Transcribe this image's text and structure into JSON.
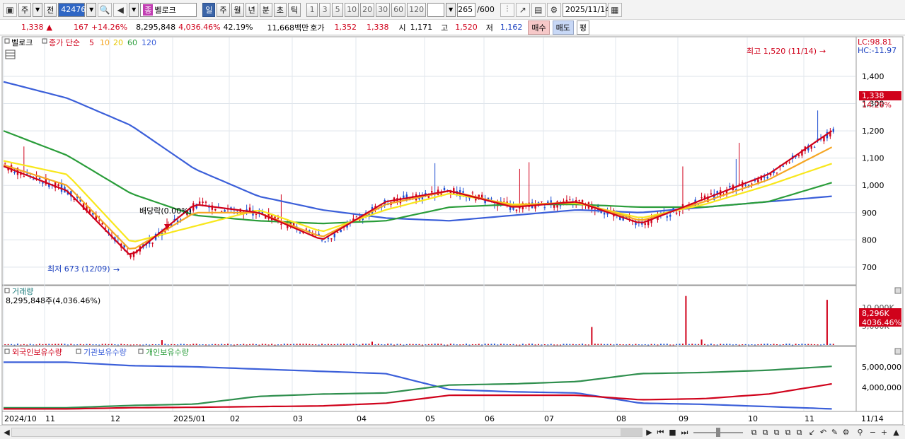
{
  "toolbar": {
    "period_sel": "주",
    "prev_label": "전",
    "stock_code": "424760",
    "stock_badge": "종",
    "stock_name": "벨로크",
    "period_buttons": [
      "일",
      "주",
      "월",
      "년",
      "분",
      "초",
      "틱"
    ],
    "interval_buttons": [
      "1",
      "3",
      "5",
      "10",
      "20",
      "30",
      "60",
      "120"
    ],
    "bar_count": "265",
    "bar_max": "/600",
    "date": "2025/11/14"
  },
  "quote": {
    "price": "1,338",
    "up_arrow": "▲",
    "change": "167",
    "change_pct": "+14.26%",
    "volume": "8,295,848",
    "volume_pct": "4,036.46%",
    "turnover_pct": "42.19%",
    "amount": "11,668백만",
    "hoga_label": "호가",
    "ask": "1,352",
    "bid": "1,338",
    "open_label": "시",
    "open": "1,171",
    "high_label": "고",
    "high": "1,520",
    "low_label": "저",
    "low": "1,162",
    "buy_label": "매수",
    "sell_label": "매도",
    "even_label": "평"
  },
  "price_panel": {
    "stock_label": "벨로크",
    "ma_title": "종가 단순",
    "ma_periods": [
      "5",
      "10",
      "20",
      "60",
      "120"
    ],
    "lc": "LC:98.81",
    "hc": "HC:-11.97",
    "high_note": "최고 1,520 (11/14)",
    "low_note": "최저 673 (12/09)",
    "dividend_note": "배당락(0.00%)",
    "price_tag": "1,338",
    "pct_tag": "14.26%",
    "y_ticks": [
      "1,400",
      "1,300",
      "1,200",
      "1,100",
      "1,000",
      "900",
      "800",
      "700"
    ]
  },
  "volume_panel": {
    "title": "거래량",
    "value_line": "8,295,848주(4,036.46%)",
    "tick_10000k": "10,000K",
    "tick_5000k": "5,000K",
    "tag_vol": "8,296K",
    "tag_pct": "4036.46%"
  },
  "holdings_panel": {
    "legend": [
      "외국인보유수량",
      "기관보유수량",
      "개인보유수량"
    ],
    "y_ticks": [
      "5,000,000",
      "4,000,000"
    ]
  },
  "x_axis": [
    "2024/10",
    "11",
    "12",
    "2025/01",
    "02",
    "03",
    "04",
    "05",
    "06",
    "07",
    "08",
    "09",
    "10",
    "11",
    "11/14"
  ],
  "chart_data": {
    "type": "line",
    "title": "벨로크",
    "ylim": [
      640,
      1540
    ],
    "price_series": {
      "name": "종가",
      "x": [
        "2024/10",
        "2024/11",
        "2024/12",
        "2025/01",
        "2025/02",
        "2025/03",
        "2025/04",
        "2025/05",
        "2025/06",
        "2025/07",
        "2025/08",
        "2025/09",
        "2025/10",
        "2025/11"
      ],
      "values": [
        1080,
        1000,
        720,
        960,
        890,
        790,
        960,
        990,
        910,
        950,
        850,
        960,
        1060,
        1338
      ]
    },
    "ma_series": [
      {
        "name": "5",
        "color": "#d0021b",
        "values": [
          1070,
          980,
          740,
          930,
          900,
          800,
          940,
          980,
          920,
          940,
          860,
          950,
          1040,
          1200
        ]
      },
      {
        "name": "10",
        "color": "#f5a623",
        "values": [
          1075,
          1000,
          760,
          900,
          900,
          810,
          930,
          980,
          925,
          940,
          870,
          940,
          1020,
          1140
        ]
      },
      {
        "name": "20",
        "color": "#f8e71c",
        "values": [
          1090,
          1040,
          790,
          850,
          910,
          830,
          910,
          970,
          930,
          935,
          880,
          930,
          1000,
          1080
        ]
      },
      {
        "name": "60",
        "color": "#2a9d3a",
        "values": [
          1200,
          1110,
          970,
          890,
          870,
          860,
          870,
          920,
          930,
          930,
          920,
          920,
          940,
          1010
        ]
      },
      {
        "name": "120",
        "color": "#3b5fd9",
        "values": [
          1380,
          1320,
          1220,
          1060,
          960,
          910,
          880,
          870,
          890,
          910,
          900,
          920,
          940,
          960
        ]
      }
    ],
    "volume_spikes_k": [
      {
        "x": "2024/11",
        "value": 900
      },
      {
        "x": "2025/01",
        "value": 600
      },
      {
        "x": "2025/05",
        "value": 9000
      },
      {
        "x": "2025/06",
        "value": 1000
      },
      {
        "x": "2025/08",
        "value": 3300
      },
      {
        "x": "2025/11",
        "value": 8296
      }
    ]
  }
}
